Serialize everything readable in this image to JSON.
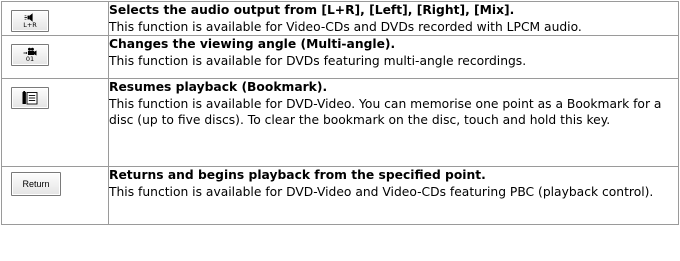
{
  "rows": [
    {
      "icon": "audio-output-speaker-icon",
      "key_text": "L+R",
      "title": "Selects the audio output from [L+R], [Left], [Right], [Mix].",
      "description": "This function is available for Video-CDs and DVDs recorded with LPCM audio."
    },
    {
      "icon": "camera-angle-icon",
      "key_text": "01",
      "title": "Changes the viewing angle (Multi-angle).",
      "description": "This function is available for DVDs featuring multi-angle recordings."
    },
    {
      "icon": "bookmark-icon",
      "key_text": "",
      "title": "Resumes playback (Bookmark).",
      "description": "This function is available for DVD-Video. You can memorise one point as a Bookmark for a disc (up to five discs). To clear the bookmark on the disc, touch and hold this key."
    },
    {
      "icon": "return-icon",
      "key_text": "Return",
      "title": "Returns and begins playback from the specified point.",
      "description": "This function is available for DVD-Video and Video-CDs featuring PBC (playback control)."
    }
  ]
}
